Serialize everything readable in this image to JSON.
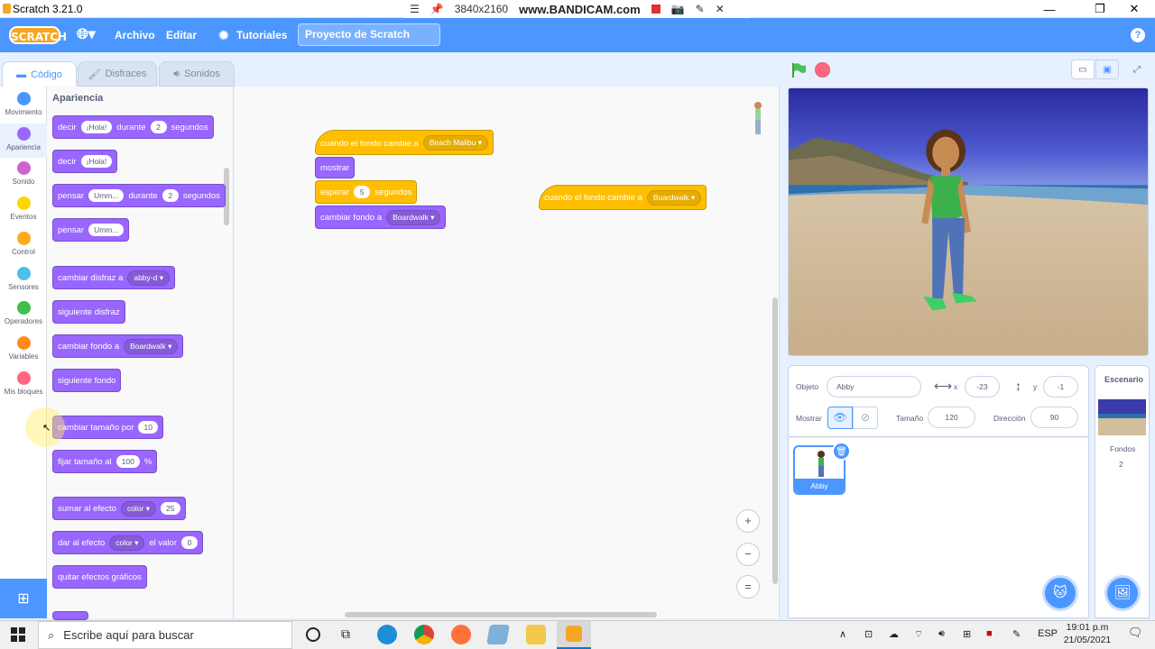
{
  "window": {
    "title": "Scratch 3.21.0",
    "app_icon": "scratch-app-icon",
    "minimize": "—",
    "maximize": "❐",
    "close": "✕"
  },
  "recorder": {
    "resolution": "3840x2160",
    "brand": "www.BANDICAM.com"
  },
  "menubar": {
    "logo": "SCRATCH",
    "language_icon": "globe-icon",
    "archivo": "Archivo",
    "editar": "Editar",
    "tutoriales": "Tutoriales",
    "project_title": "Proyecto de Scratch",
    "help_icon": "?"
  },
  "tabs": {
    "code": "Código",
    "costumes": "Disfraces",
    "sounds": "Sonidos"
  },
  "categories": [
    {
      "label": "Movimiento",
      "color": "#4c97ff"
    },
    {
      "label": "Apariencia",
      "color": "#9966ff"
    },
    {
      "label": "Sonido",
      "color": "#cf63cf"
    },
    {
      "label": "Eventos",
      "color": "#ffd500"
    },
    {
      "label": "Control",
      "color": "#ffab19"
    },
    {
      "label": "Sensores",
      "color": "#4cbfe6"
    },
    {
      "label": "Operadores",
      "color": "#40bf4a"
    },
    {
      "label": "Variables",
      "color": "#ff8c1a"
    },
    {
      "label": "Mis bloques",
      "color": "#ff6680"
    }
  ],
  "palette": {
    "heading": "Apariencia",
    "say_for": {
      "a": "decir",
      "msg": "¡Hola!",
      "b": "durante",
      "secs": "2",
      "c": "segundos"
    },
    "say": {
      "a": "decir",
      "msg": "¡Hola!"
    },
    "think_for": {
      "a": "pensar",
      "msg": "Umm...",
      "b": "durante",
      "secs": "2",
      "c": "segundos"
    },
    "think": {
      "a": "pensar",
      "msg": "Umm..."
    },
    "switch_costume": {
      "a": "cambiar disfraz a",
      "v": "abby-d"
    },
    "next_costume": "siguiente disfraz",
    "switch_backdrop": {
      "a": "cambiar fondo a",
      "v": "Boardwalk"
    },
    "next_backdrop": "siguiente fondo",
    "change_size": {
      "a": "cambiar tamaño por",
      "v": "10"
    },
    "set_size": {
      "a": "fijar tamaño al",
      "v": "100",
      "b": "%"
    },
    "change_effect": {
      "a": "sumar al efecto",
      "v": "color",
      "b": "25"
    },
    "set_effect": {
      "a": "dar al efecto",
      "v": "color",
      "b": "el valor",
      "n": "0"
    },
    "clear_effects": "quitar efectos gráficos"
  },
  "script1": {
    "hat": {
      "a": "cuando el fondo cambie a",
      "v": "Beach Malibu"
    },
    "show": "mostrar",
    "wait": {
      "a": "esperar",
      "v": "5",
      "b": "segundos"
    },
    "switch": {
      "a": "cambiar fondo a",
      "v": "Boardwalk"
    }
  },
  "script2": {
    "hat": {
      "a": "cuando el fondo cambie a",
      "v": "Boardwalk"
    }
  },
  "zoom": {
    "in": "+",
    "out": "−",
    "reset": "="
  },
  "sprite_info": {
    "objeto_label": "Objeto",
    "name": "Abby",
    "x_label": "x",
    "x": "-23",
    "y_label": "y",
    "y": "-1",
    "mostrar_label": "Mostrar",
    "size_label": "Tamaño",
    "size": "120",
    "dir_label": "Dirección",
    "dir": "90"
  },
  "sprite_card": {
    "name": "Abby"
  },
  "stage_panel": {
    "title": "Escenario",
    "backdrops_label": "Fondos",
    "backdrops_count": "2"
  },
  "taskbar": {
    "search": "Escribe aquí para buscar",
    "lang": "ESP",
    "time": "19:01 p.m",
    "date": "21/05/2021"
  }
}
